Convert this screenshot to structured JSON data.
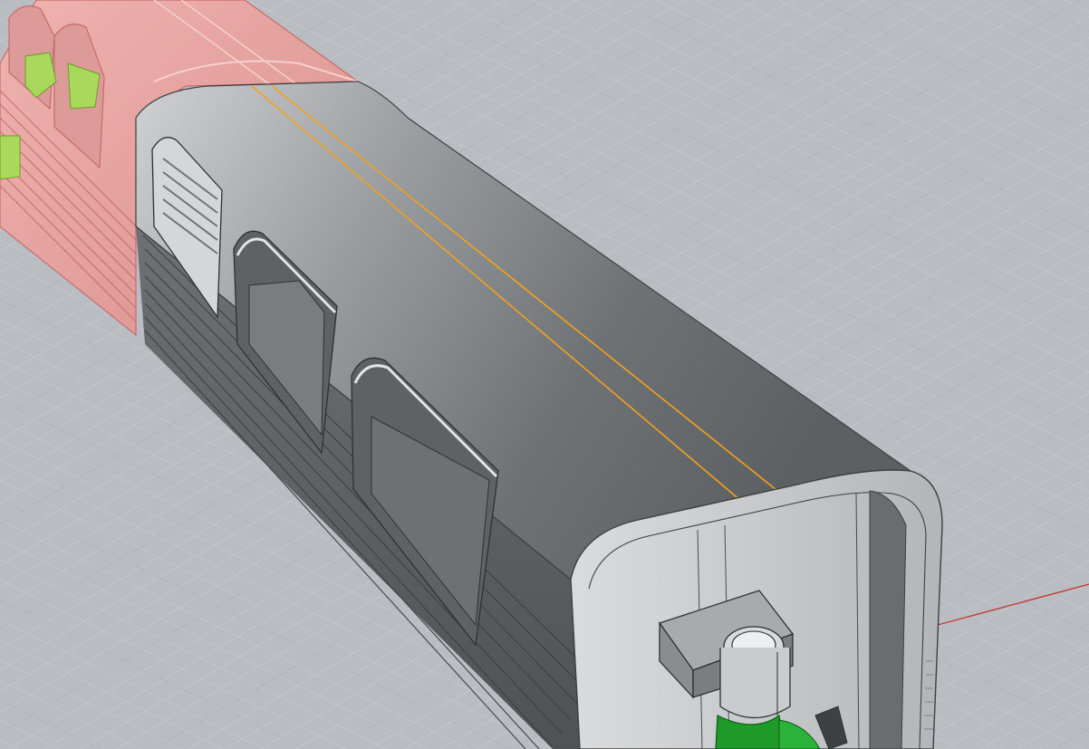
{
  "viewport": {
    "view": "perspective",
    "background_color": "#b9bdc1",
    "grid_minor_color": "#cfd2d5",
    "grid_major_color": "#a7abaf",
    "x_axis_color": "#c23a3a"
  },
  "model": {
    "selected_part_color": "#e9a3a0",
    "selected_part_edge_color": "#c66b6b",
    "shell_color": "#8b8e91",
    "shell_light_color": "#cfd1d3",
    "shell_dark_color": "#5d6063",
    "inner_part_green": "#1e9a2a",
    "inner_part_lime": "#a9d95a",
    "highlight_edge_color": "#f2a21c"
  }
}
